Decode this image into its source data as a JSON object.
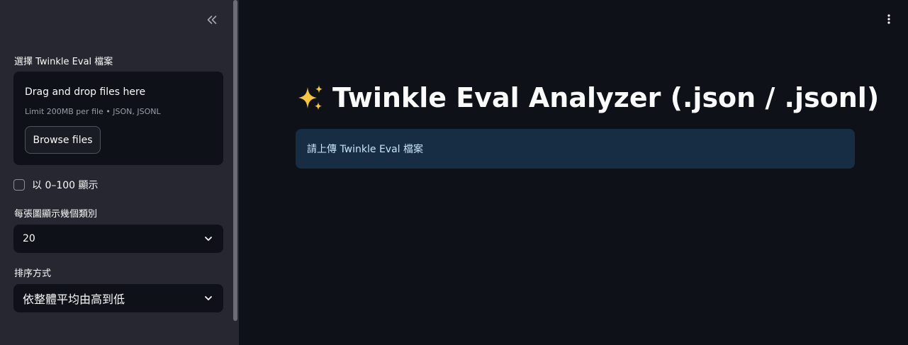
{
  "sidebar": {
    "file_label": "選擇 Twinkle Eval 檔案",
    "uploader": {
      "title": "Drag and drop files here",
      "hint": "Limit 200MB per file • JSON, JSONL",
      "browse_label": "Browse files"
    },
    "checkbox_label": "以 0–100 顯示",
    "checkbox_checked": false,
    "categories_label": "每張圖顯示幾個類別",
    "categories_value": "20",
    "sort_label": "排序方式",
    "sort_value": "依整體平均由高到低"
  },
  "main": {
    "title": "Twinkle Eval Analyzer (.json / .jsonl)",
    "info": "請上傳 Twinkle Eval 檔案"
  },
  "colors": {
    "background": "#0e1117",
    "sidebar": "#262730",
    "info_bg": "#172d43",
    "info_text": "#c7e4fb",
    "sparkle": "#f5c542"
  },
  "icons": [
    "collapse-sidebar-icon",
    "chevron-down-icon",
    "kebab-menu-icon",
    "sparkles-icon"
  ]
}
